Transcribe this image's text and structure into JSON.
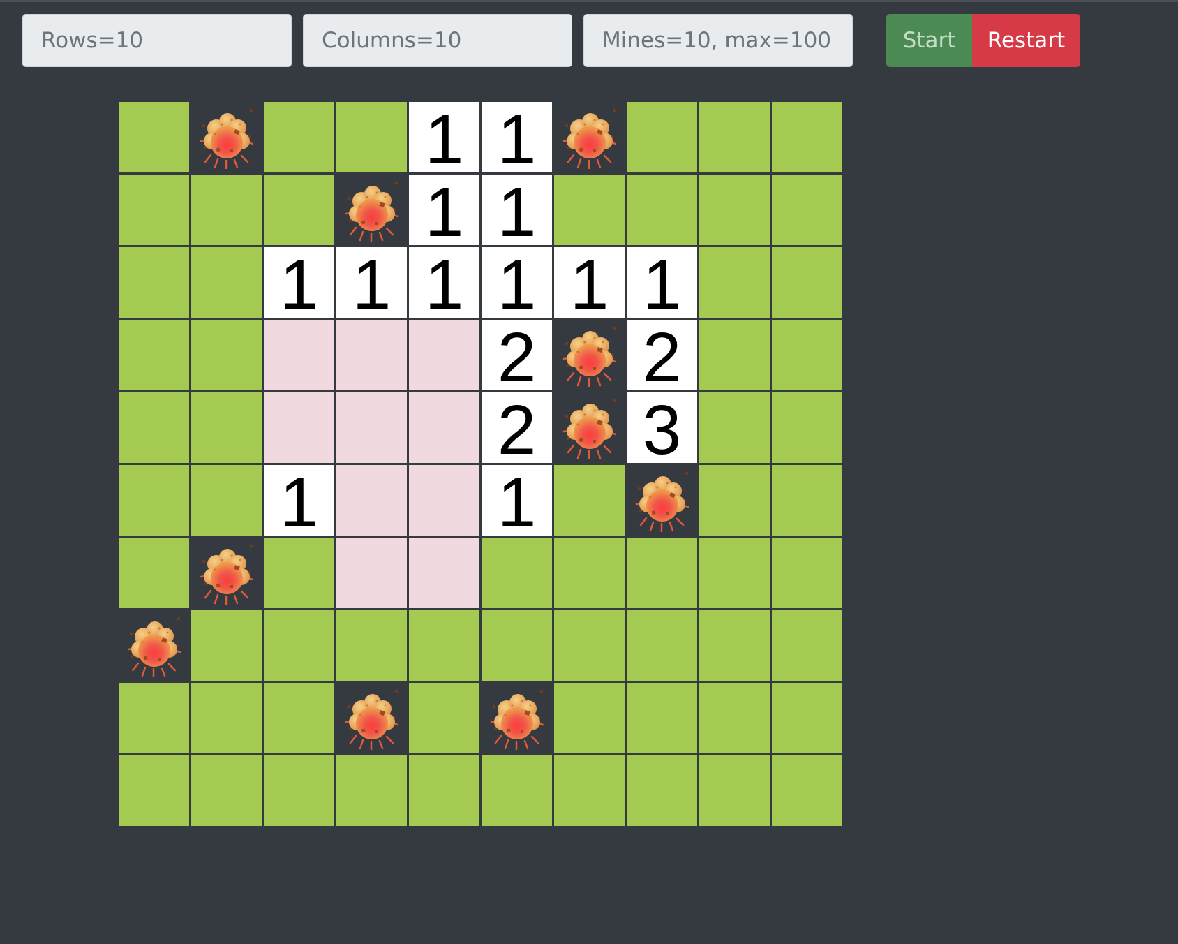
{
  "settings": {
    "rows_placeholder": "Rows=10",
    "columns_placeholder": "Columns=10",
    "mines_placeholder": "Mines=10, max=100"
  },
  "buttons": {
    "start_label": "Start",
    "restart_label": "Restart"
  },
  "board": {
    "rows": 10,
    "columns": 10,
    "cells": [
      [
        "H",
        "M",
        "H",
        "H",
        "1",
        "1",
        "M",
        "H",
        "H",
        "H"
      ],
      [
        "H",
        "H",
        "H",
        "M",
        "1",
        "1",
        "H",
        "H",
        "H",
        "H"
      ],
      [
        "H",
        "H",
        "1",
        "1",
        "1",
        "1",
        "1",
        "1",
        "H",
        "H"
      ],
      [
        "H",
        "H",
        "E",
        "E",
        "E",
        "2",
        "M",
        "2",
        "H",
        "H"
      ],
      [
        "H",
        "H",
        "E",
        "E",
        "E",
        "2",
        "M",
        "3",
        "H",
        "H"
      ],
      [
        "H",
        "H",
        "1",
        "E",
        "E",
        "1",
        "H",
        "M",
        "H",
        "H"
      ],
      [
        "H",
        "M",
        "H",
        "E",
        "E",
        "H",
        "H",
        "H",
        "H",
        "H"
      ],
      [
        "M",
        "H",
        "H",
        "H",
        "H",
        "H",
        "H",
        "H",
        "H",
        "H"
      ],
      [
        "H",
        "H",
        "H",
        "M",
        "H",
        "M",
        "H",
        "H",
        "H",
        "H"
      ],
      [
        "H",
        "H",
        "H",
        "H",
        "H",
        "H",
        "H",
        "H",
        "H",
        "H"
      ]
    ],
    "legend": {
      "H": "hidden",
      "E": "revealed-empty",
      "M": "mine",
      "digit": "revealed-number"
    }
  },
  "colors": {
    "background": "#343a40",
    "hidden_cell": "#a5ca52",
    "number_cell": "#ffffff",
    "empty_cell": "#f0dae0",
    "start_button": "#4b8a52",
    "restart_button": "#d73a47"
  },
  "icons": {
    "mine": "explosion-icon"
  }
}
